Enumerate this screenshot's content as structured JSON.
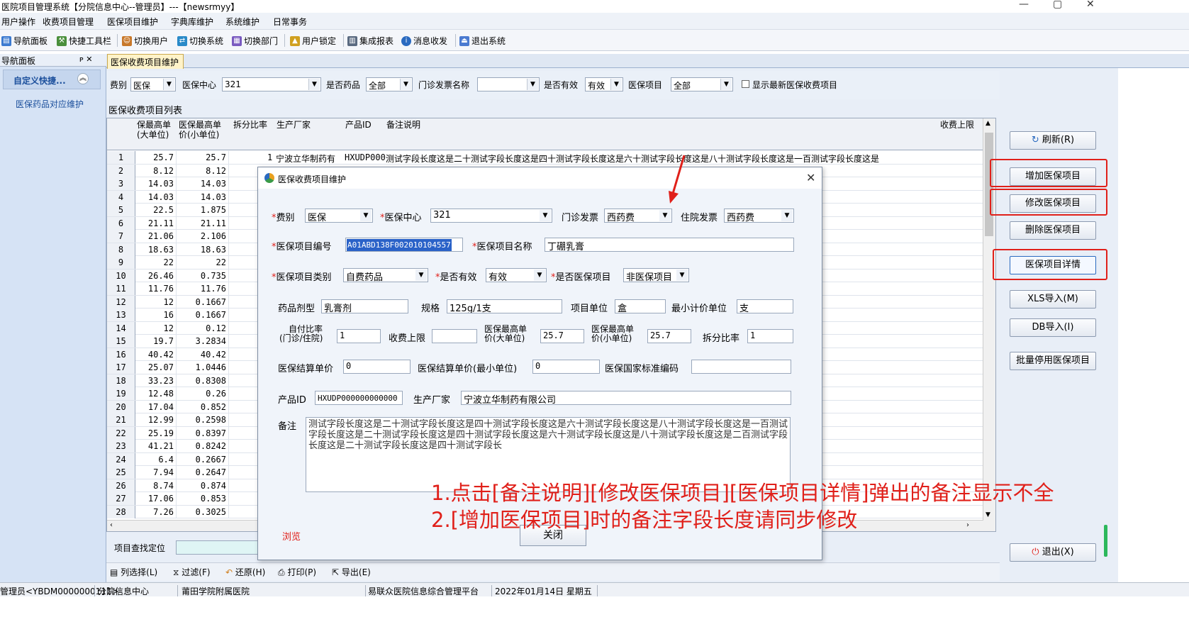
{
  "window": {
    "title": "医院项目管理系统【分院信息中心--管理员】---【newsrmyy】",
    "controls": [
      "—",
      "▢",
      "✕"
    ]
  },
  "menu": [
    "用户操作",
    "收费项目管理",
    "医保项目维护",
    "字典库维护",
    "系统维护",
    "日常事务"
  ],
  "toolbar": [
    "导航面板",
    "快捷工具栏",
    "切换用户",
    "切换系统",
    "切换部门",
    "用户锁定",
    "集成报表",
    "消息收发",
    "退出系统"
  ],
  "nav": {
    "header": "导航面板",
    "pin": "ᴘ ✕",
    "section": "自定义快捷...",
    "item": "医保药品对应维护"
  },
  "tab": "医保收费项目维护",
  "filter": {
    "fee_type_label": "费别",
    "fee_type": "医保",
    "center_label": "医保中心",
    "center": "321",
    "is_drug_label": "是否药品",
    "is_drug": "全部",
    "invoice_label": "门诊发票名称",
    "invoice": "",
    "valid_label": "是否有效",
    "valid": "有效",
    "item_label": "医保项目",
    "item": "全部",
    "latest_label": "显示最新医保收费项目"
  },
  "grid": {
    "title": "医保收费项目列表",
    "headers": {
      "c1": "保最高单\n(大单位)",
      "c2": "医保最高单\n价(小单位)",
      "c3": "拆分比率",
      "c4": "生产厂家",
      "c5": "产品ID",
      "c6": "备注说明",
      "c7": "收费上限"
    },
    "row1": {
      "split": "1",
      "maker": "宁波立华制药有",
      "pid": "HXUDP000",
      "remark": "测试字段长度这是二十测试字段长度这是四十测试字段长度这是六十测试字段长度这是八十测试字段长度这是一百测试字段长度这是"
    },
    "rows": [
      {
        "n": "1",
        "a": "25.7",
        "b": "25.7"
      },
      {
        "n": "2",
        "a": "8.12",
        "b": "8.12"
      },
      {
        "n": "3",
        "a": "14.03",
        "b": "14.03"
      },
      {
        "n": "4",
        "a": "14.03",
        "b": "14.03"
      },
      {
        "n": "5",
        "a": "22.5",
        "b": "1.875"
      },
      {
        "n": "6",
        "a": "21.11",
        "b": "21.11"
      },
      {
        "n": "7",
        "a": "21.06",
        "b": "2.106"
      },
      {
        "n": "8",
        "a": "18.63",
        "b": "18.63"
      },
      {
        "n": "9",
        "a": "22",
        "b": "22"
      },
      {
        "n": "10",
        "a": "26.46",
        "b": "0.735"
      },
      {
        "n": "11",
        "a": "11.76",
        "b": "11.76"
      },
      {
        "n": "12",
        "a": "12",
        "b": "0.1667"
      },
      {
        "n": "13",
        "a": "16",
        "b": "0.1667"
      },
      {
        "n": "14",
        "a": "12",
        "b": "0.12"
      },
      {
        "n": "15",
        "a": "19.7",
        "b": "3.2834"
      },
      {
        "n": "16",
        "a": "40.42",
        "b": "40.42"
      },
      {
        "n": "17",
        "a": "25.07",
        "b": "1.0446"
      },
      {
        "n": "18",
        "a": "33.23",
        "b": "0.8308"
      },
      {
        "n": "19",
        "a": "12.48",
        "b": "0.26"
      },
      {
        "n": "20",
        "a": "17.04",
        "b": "0.852"
      },
      {
        "n": "21",
        "a": "12.99",
        "b": "0.2598"
      },
      {
        "n": "22",
        "a": "25.19",
        "b": "0.8397"
      },
      {
        "n": "23",
        "a": "41.21",
        "b": "0.8242"
      },
      {
        "n": "24",
        "a": "6.4",
        "b": "0.2667"
      },
      {
        "n": "25",
        "a": "7.94",
        "b": "0.2647"
      },
      {
        "n": "26",
        "a": "8.74",
        "b": "0.874"
      },
      {
        "n": "27",
        "a": "17.06",
        "b": "0.853"
      },
      {
        "n": "28",
        "a": "7.26",
        "b": "0.3025"
      }
    ]
  },
  "search_label": "项目查找定位",
  "bottom_tools": [
    "列选择(L)",
    "过滤(F)",
    "还原(H)",
    "打印(P)",
    "导出(E)"
  ],
  "right_buttons": {
    "refresh": "刷新(R)",
    "add": "增加医保项目",
    "edit": "修改医保项目",
    "delete": "删除医保项目",
    "detail": "医保项目详情",
    "xls": "XLS导入(M)",
    "db": "DB导入(I)",
    "batch": "批量停用医保项目",
    "exit": "退出(X)"
  },
  "status": [
    "管理员<YBDM0000000111>",
    "分院信息中心",
    "莆田学院附属医院",
    "易联众医院信息综合管理平台",
    "2022年01月14日 星期五"
  ],
  "dialog": {
    "title": "医保收费项目维护",
    "close": "✕",
    "fee_type_label": "费别",
    "fee_type": "医保",
    "center_label": "医保中心",
    "center": "321",
    "op_invoice_label": "门诊发票",
    "op_invoice": "西药费",
    "ip_invoice_label": "住院发票",
    "ip_invoice": "西药费",
    "code_label": "医保项目编号",
    "code": "A01ABD138F002010104557",
    "name_label": "医保项目名称",
    "name": "丁硼乳膏",
    "category_label": "医保项目类别",
    "category": "自费药品",
    "valid_label": "是否有效",
    "valid": "有效",
    "is_ins_label": "是否医保项目",
    "is_ins": "非医保项目",
    "dosage_label": "药品剂型",
    "dosage": "乳膏剂",
    "spec_label": "规格",
    "spec": "125g/1支",
    "unit_label": "项目单位",
    "unit": "盒",
    "min_unit_label": "最小计价单位",
    "min_unit": "支",
    "self_ratio_label_1": "自付比率",
    "self_ratio_label_2": "(门诊/住院)",
    "self_ratio": "1",
    "fee_limit_label": "收费上限",
    "fee_limit": "",
    "max_big_label_1": "医保最高单",
    "max_big_label_2": "价(大单位)",
    "max_big": "25.7",
    "max_small_label_1": "医保最高单",
    "max_small_label_2": "价(小单位)",
    "max_small": "25.7",
    "split_label": "拆分比率",
    "split": "1",
    "settle_label": "医保结算单价",
    "settle": "0",
    "settle_min_label": "医保结算单价(最小单位)",
    "settle_min": "0",
    "national_label": "医保国家标准编码",
    "national": "",
    "pid_label": "产品ID",
    "pid": "HXUDP000000000000",
    "maker_label": "生产厂家",
    "maker": "宁波立华制药有限公司",
    "remark_label": "备注",
    "remark": "测试字段长度这是二十测试字段长度这是四十测试字段长度这是六十测试字段长度这是八十测试字段长度这是一百测试字段长度这是二十测试字段长度这是四十测试字段长度这是六十测试字段长度这是八十测试字段长度这是二百测试字段长度这是二十测试字段长度这是四十测试字段长",
    "browse": "浏览",
    "close_button": "关闭"
  },
  "annotation": {
    "line1": "1.点击[备注说明][修改医保项目][医保项目详情]弹出的备注显示不全",
    "line2": "2.[增加医保项目]时的备注字段长度请同步修改"
  },
  "colors": {
    "accent_red": "#e0201a",
    "nav_bg": "#d6e3f5",
    "tab_bg": "#fff3c9"
  }
}
